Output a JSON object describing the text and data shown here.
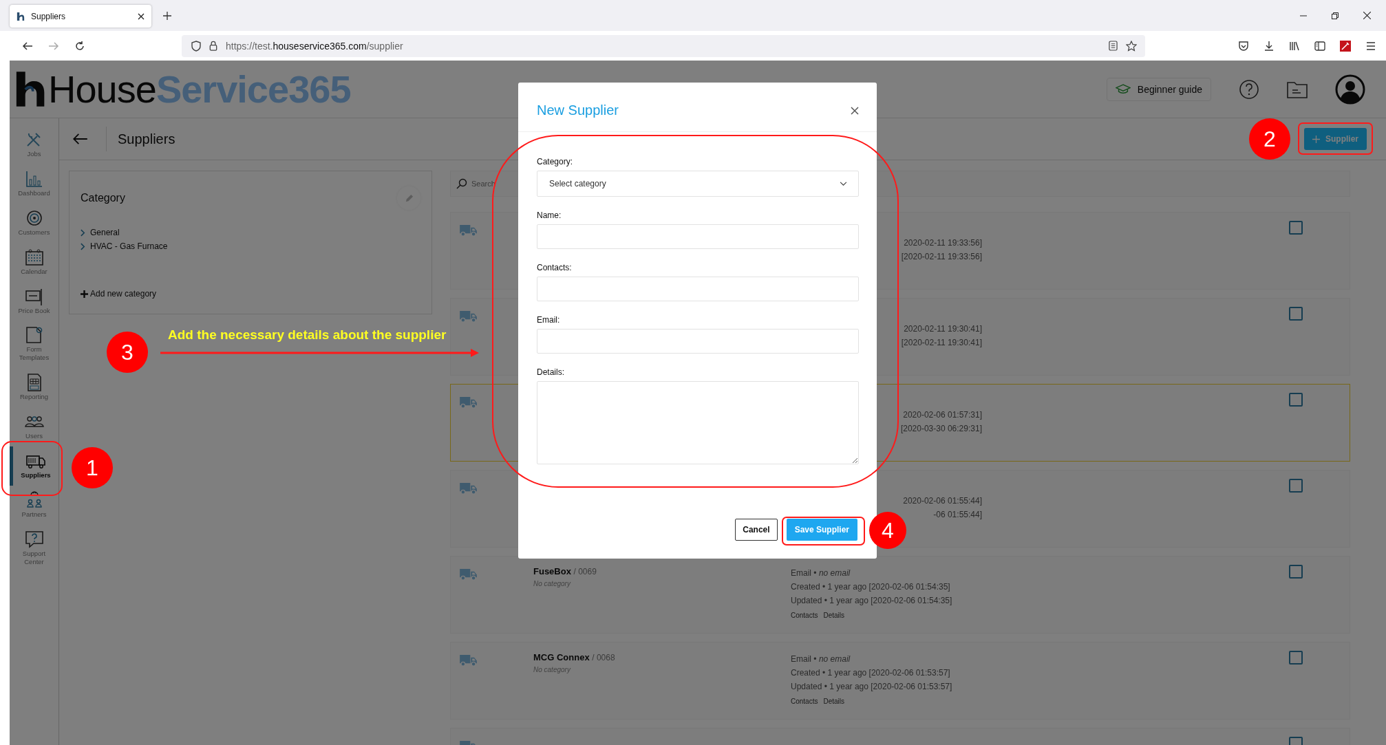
{
  "browser": {
    "tab_title": "Suppliers",
    "url_prefix": "https://test.",
    "url_domain": "houseservice365.com",
    "url_path": "/supplier"
  },
  "header": {
    "logo_dark": "House",
    "logo_accent": "Service365",
    "guide_button": "Beginner guide"
  },
  "sidebar": {
    "items": [
      {
        "label": "Jobs",
        "selected": false
      },
      {
        "label": "Dashboard",
        "selected": false
      },
      {
        "label": "Customers",
        "selected": false
      },
      {
        "label": "Calendar",
        "selected": false
      },
      {
        "label": "Price Book",
        "selected": false
      },
      {
        "label": "Form Templates",
        "selected": false
      },
      {
        "label": "Reporting",
        "selected": false
      },
      {
        "label": "Users",
        "selected": false
      },
      {
        "label": "Suppliers",
        "selected": true
      },
      {
        "label": "Partners",
        "selected": false
      },
      {
        "label": "Support Center",
        "selected": false
      }
    ]
  },
  "page": {
    "title": "Suppliers",
    "add_button": "Supplier"
  },
  "category_panel": {
    "title": "Category",
    "items": [
      {
        "label": "General",
        "expanded": false
      },
      {
        "label": "HVAC - Gas Furnace",
        "expanded": false
      }
    ],
    "add_link": "Add new category"
  },
  "search": {
    "placeholder": "Search"
  },
  "suppliers": [
    {
      "kind": "partial",
      "highlighted": false,
      "checked": false,
      "created": "2020-02-11 19:33:56]",
      "updated": "[2020-02-11 19:33:56]"
    },
    {
      "kind": "partial",
      "highlighted": false,
      "checked": false,
      "created": "2020-02-11 19:30:41]",
      "updated": "[2020-02-11 19:30:41]"
    },
    {
      "kind": "partial",
      "highlighted": true,
      "checked": false,
      "created": "2020-02-06 01:57:31]",
      "updated": "[2020-03-30 06:29:31]"
    },
    {
      "kind": "partial",
      "highlighted": false,
      "checked": false,
      "created": "2020-02-06 01:55:44]",
      "updated": "-06 01:55:44]"
    },
    {
      "kind": "full",
      "highlighted": false,
      "checked": false,
      "name": "FuseBox",
      "number": "/ 0069",
      "category": "No category",
      "email": "Email • *no email*",
      "created": "Created • 1 year ago [2020-02-06 01:54:35]",
      "updated": "Updated • 1 year ago [2020-02-06 01:54:35]",
      "links": [
        "Contacts",
        "Details"
      ]
    },
    {
      "kind": "full",
      "highlighted": false,
      "checked": false,
      "name": "MCG Connex",
      "number": "/ 0068",
      "category": "No category",
      "email": "Email • *no email*",
      "created": "Created • 1 year ago [2020-02-06 01:53:57]",
      "updated": "Updated • 1 year ago [2020-02-06 01:53:57]",
      "links": [
        "Contacts",
        "Details"
      ]
    },
    {
      "kind": "cut",
      "highlighted": false,
      "checked": false
    }
  ],
  "modal": {
    "title": "New Supplier",
    "fields": [
      {
        "label": "Category:",
        "kind": "select",
        "placeholder": "Select category"
      },
      {
        "label": "Name:",
        "kind": "text"
      },
      {
        "label": "Contacts:",
        "kind": "text"
      },
      {
        "label": "Email:",
        "kind": "text"
      },
      {
        "label": "Details:",
        "kind": "textarea"
      }
    ],
    "buttons": [
      {
        "label": "Cancel",
        "kind": "secondary"
      },
      {
        "label": "Save Supplier",
        "kind": "primary"
      }
    ]
  },
  "annotations": {
    "markers": [
      {
        "number": "1"
      },
      {
        "number": "2"
      },
      {
        "number": "3"
      },
      {
        "number": "4"
      }
    ],
    "instruction": "Add the necessary details about the supplier"
  }
}
